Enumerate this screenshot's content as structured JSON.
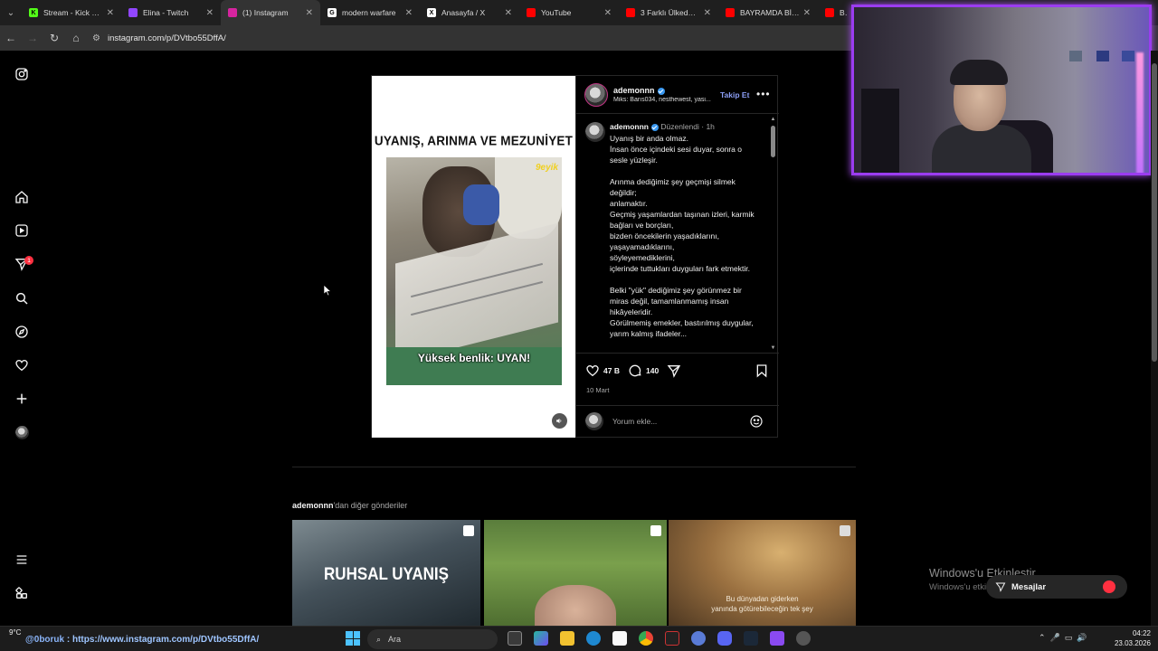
{
  "browser": {
    "tabs": [
      {
        "title": "Stream - Kick Dash",
        "icon_color": "#53fc18",
        "icon_char": "K"
      },
      {
        "title": "Elina - Twitch",
        "icon_color": "#9146ff",
        "icon_char": ""
      },
      {
        "title": "(1) Instagram",
        "icon_color": "#d6249f",
        "icon_char": "",
        "active": true
      },
      {
        "title": "modern warfare",
        "icon_color": "#ffffff",
        "icon_char": "G"
      },
      {
        "title": "Anasayfa / X",
        "icon_color": "#ffffff",
        "icon_char": "X"
      },
      {
        "title": "YouTube",
        "icon_color": "#ff0000",
        "icon_char": ""
      },
      {
        "title": "3 Farklı Ülkeden K",
        "icon_color": "#ff0000",
        "icon_char": ""
      },
      {
        "title": "BAYRAMDA BİTTİ",
        "icon_color": "#ff0000",
        "icon_char": ""
      },
      {
        "title": "BAY",
        "icon_color": "#ff0000",
        "icon_char": ""
      }
    ],
    "url": "instagram.com/p/DVtbo55DffA/"
  },
  "sidebar": {
    "items": [
      "instagram-logo",
      "home-icon",
      "reels-icon",
      "messages-icon",
      "search-icon",
      "explore-icon",
      "notifications-icon",
      "create-icon",
      "profile-avatar",
      "menu-icon",
      "more-apps-icon"
    ],
    "messages_badge": "1"
  },
  "post": {
    "media_title": "UYANIŞ, ARINMA VE MEZUNİYET",
    "watermark": "9eyik",
    "subtitle": "Yüksek benlik: UYAN!",
    "username": "ademonnn",
    "music": "Miks: Barıs034, nesthewest, yasi...",
    "follow_label": "Takip Et",
    "more_label": "•••",
    "caption_user": "ademonnn",
    "caption_meta": "Düzenlendi · 1h",
    "caption_text": "Uyanış bir anda olmaz.\nİnsan önce içindeki sesi duyar, sonra o sesle yüzleşir.\n\nArınma dediğimiz şey geçmişi silmek değildir;\nanlamaktır.\nGeçmiş yaşamlardan taşınan izleri, karmik bağları ve borçları,\nbizden öncekilerin yaşadıklarını,\nyaşayamadıklarını,\nsöyleyemediklerini,\niçlerinde tuttukları duyguları fark etmektir.\n\nBelki \"yük\" dediğimiz şey görünmez bir miras değil, tamamlanmamış insan hikâyeleridir.\nGörülmemiş emekler, bastırılmış duygular, yarım kalmış ifadeler...",
    "likes": "47 B",
    "comments": "140",
    "date": "10 Mart",
    "comment_placeholder": "Yorum ekle..."
  },
  "more_posts": {
    "title_user": "ademonnn",
    "title_rest": "'dan diğer gönderiler",
    "items": [
      {
        "text": "RUHSAL UYANIŞ"
      },
      {
        "text": ""
      },
      {
        "text": "Bu dünyadan giderken\nyanında götürebileceğin tek şey"
      }
    ]
  },
  "overlay": {
    "activate_title": "Windows'u Etkinleştir",
    "activate_sub": "Windows'u etkinleştirmek için Ayarlar'a gidin.",
    "messages_label": "Mesajlar"
  },
  "status": {
    "user": "@0boruk",
    "link": "https://www.instagram.com/p/DVtbo55DffA/"
  },
  "taskbar": {
    "weather": "9°C",
    "search_label": "Ara",
    "time": "04:22",
    "date": "23.03.2026"
  }
}
